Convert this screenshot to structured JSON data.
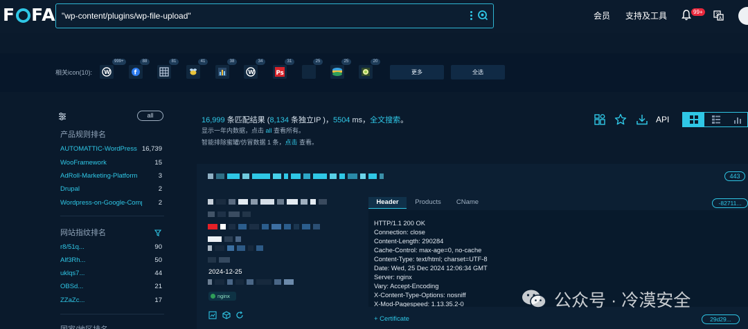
{
  "brand": {
    "logo_left": "F",
    "logo_right": "FA"
  },
  "search": {
    "query": "\"wp-content/plugins/wp-file-upload\""
  },
  "nav": {
    "member": "会员",
    "support": "支持及工具",
    "notif_badge": "99+"
  },
  "icon_strip": {
    "label": "相关icon(10):",
    "icons": [
      {
        "name": "wordpress-icon",
        "glyph": "W",
        "count": "999+",
        "color": "#ffffff"
      },
      {
        "name": "blue-circle-icon",
        "glyph": "f",
        "count": "88",
        "color": "#2d7bef"
      },
      {
        "name": "grid-icon",
        "glyph": "▦",
        "count": "81",
        "color": "#c7d6ea"
      },
      {
        "name": "bee-icon",
        "glyph": "✦",
        "count": "41",
        "color": "#e8c33a"
      },
      {
        "name": "chart-icon",
        "glyph": "▣",
        "count": "38",
        "color": "#7fc7ff"
      },
      {
        "name": "wordpress-alt-icon",
        "glyph": "W",
        "count": "34",
        "color": "#ffffff"
      },
      {
        "name": "ps-icon",
        "glyph": "Ps",
        "count": "31",
        "color": "#ffffff"
      },
      {
        "name": "blank-icon",
        "glyph": "",
        "count": "25",
        "color": "#10273e"
      },
      {
        "name": "stack-icon",
        "glyph": "≡",
        "count": "25",
        "color": "#f0c040"
      },
      {
        "name": "sparkle-icon",
        "glyph": "✺",
        "count": "20",
        "color": "#e9f0a0"
      }
    ],
    "more": "更多",
    "select_all": "全选"
  },
  "sidebar": {
    "all_label": "all",
    "product_title": "产品规则排名",
    "products": [
      {
        "name": "AUTOMATTIC-WordPress",
        "count": "16,739"
      },
      {
        "name": "WooFramework",
        "count": "15"
      },
      {
        "name": "AdRoll-Marketing-Platform",
        "count": "3"
      },
      {
        "name": "Drupal",
        "count": "2"
      },
      {
        "name": "Wordpress-on-Google-Compu...",
        "count": "2"
      }
    ],
    "fingerprint_title": "网站指纹排名",
    "fingerprints": [
      {
        "name": "r8/51q...",
        "count": "90"
      },
      {
        "name": "Alf3Rh...",
        "count": "50"
      },
      {
        "name": "uklqs7...",
        "count": "44"
      },
      {
        "name": "OBSd...",
        "count": "21"
      },
      {
        "name": "ZZaZc...",
        "count": "17"
      }
    ],
    "country_title": "国家/地区排名"
  },
  "summary": {
    "total": "16,999",
    "total_suffix": " 条匹配结果 (",
    "ips": "8,134",
    "ips_suffix": " 条独立IP )，",
    "ms": "5504",
    "ms_suffix": " ms，",
    "fulltext": "全文搜索",
    "fulltext_suffix": "。",
    "line2_prefix": "显示一年内数据，点击 ",
    "line2_link": "all",
    "line2_suffix": " 查看所有。",
    "line3_prefix": "智能排除蜜罐/仿冒数据 1 条，",
    "line3_link": "点击",
    "line3_suffix": " 查看。"
  },
  "toolbar": {
    "api": "API"
  },
  "result": {
    "port": "443",
    "date": "2024-12-25",
    "server_tag": "nginx",
    "tabs": [
      "Header",
      "Products",
      "CName"
    ],
    "hash_top": "-82711...",
    "header_lines": [
      "HTTP/1.1 200 OK",
      "Connection: close",
      "Content-Length: 290284",
      "Cache-Control: max-age=0, no-cache",
      "Content-Type: text/html; charset=UTF-8",
      "Date: Wed, 25 Dec 2024 12:06:34 GMT",
      "Server: nginx",
      "Vary: Accept-Encoding",
      "X-Content-Type-Options: nosniff",
      "X-Mod-Pagespeed: 1.13.35.2-0"
    ],
    "certificate": "+ Certificate",
    "hash_bottom": "29d29..."
  },
  "watermark": {
    "text": "公众号 · 冷漠安全"
  },
  "colors": {
    "accent": "#2fc7e6",
    "background": "#0a1a2c",
    "badge": "#e8283c"
  }
}
